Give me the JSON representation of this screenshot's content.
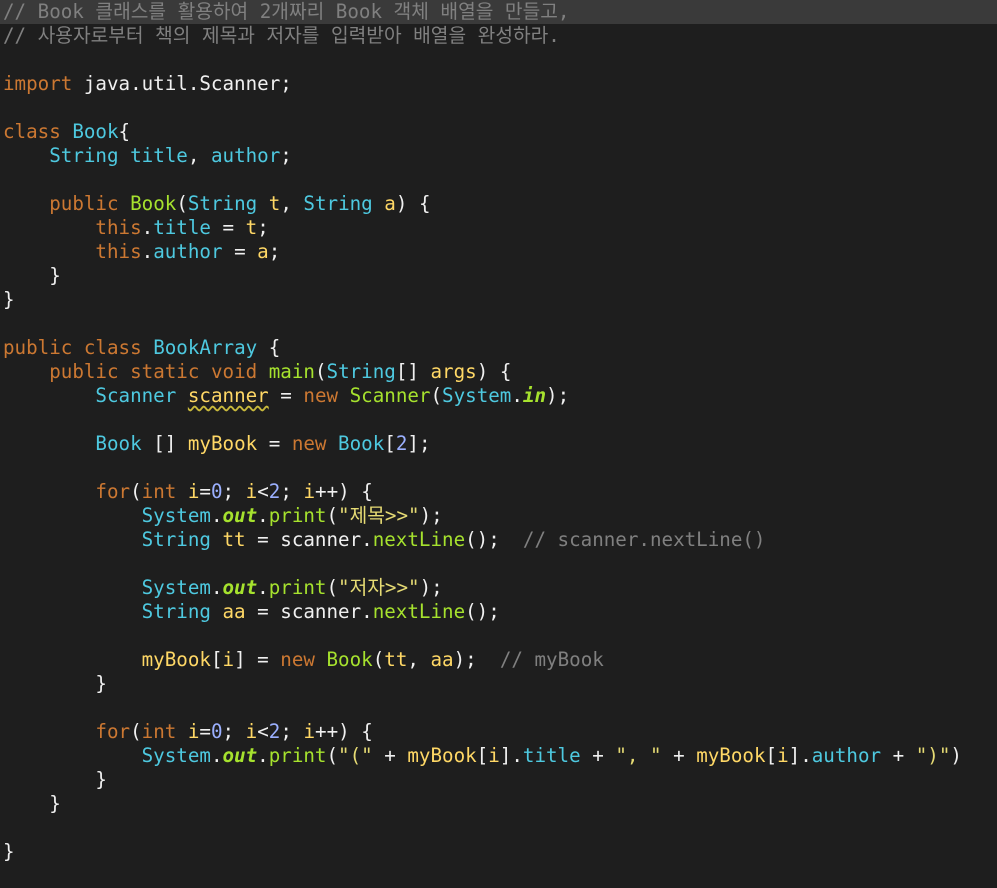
{
  "editor": {
    "language": "java",
    "colors": {
      "background": "#1e1e1e",
      "comment": "#808080",
      "keyword": "#cc7832",
      "type": "#4ec9e0",
      "method": "#a6e22e",
      "string": "#e6db74",
      "number": "#9bb0ff",
      "field": "#ffd866"
    },
    "lines": [
      {
        "highlight": true,
        "tokens": [
          {
            "t": "// Book 클래스를 활용하여 2개짜리 Book 객체 배열을 만들고,",
            "c": "comment"
          }
        ]
      },
      {
        "tokens": [
          {
            "t": "// 사용자로부터 책의 제목과 저자를 입력받아 배열을 완성하라.",
            "c": "comment"
          }
        ]
      },
      {
        "tokens": []
      },
      {
        "tokens": [
          {
            "t": "import",
            "c": "keyword"
          },
          {
            "t": " java.util.Scanner;",
            "c": "plain"
          }
        ]
      },
      {
        "tokens": []
      },
      {
        "tokens": [
          {
            "t": "class",
            "c": "keyword"
          },
          {
            "t": " ",
            "c": "plain"
          },
          {
            "t": "Book",
            "c": "class"
          },
          {
            "t": "{",
            "c": "plain"
          }
        ]
      },
      {
        "tokens": [
          {
            "t": "    ",
            "c": "plain"
          },
          {
            "t": "String",
            "c": "type"
          },
          {
            "t": " ",
            "c": "plain"
          },
          {
            "t": "title",
            "c": "type"
          },
          {
            "t": ", ",
            "c": "plain"
          },
          {
            "t": "author",
            "c": "type"
          },
          {
            "t": ";",
            "c": "plain"
          }
        ]
      },
      {
        "tokens": []
      },
      {
        "tokens": [
          {
            "t": "    ",
            "c": "plain"
          },
          {
            "t": "public",
            "c": "keyword"
          },
          {
            "t": " ",
            "c": "plain"
          },
          {
            "t": "Book",
            "c": "ctor"
          },
          {
            "t": "(",
            "c": "plain"
          },
          {
            "t": "String",
            "c": "type"
          },
          {
            "t": " ",
            "c": "plain"
          },
          {
            "t": "t",
            "c": "param"
          },
          {
            "t": ", ",
            "c": "plain"
          },
          {
            "t": "String",
            "c": "type"
          },
          {
            "t": " ",
            "c": "plain"
          },
          {
            "t": "a",
            "c": "param"
          },
          {
            "t": ") {",
            "c": "plain"
          }
        ]
      },
      {
        "tokens": [
          {
            "t": "        ",
            "c": "plain"
          },
          {
            "t": "this",
            "c": "keyword"
          },
          {
            "t": ".",
            "c": "plain"
          },
          {
            "t": "title",
            "c": "type"
          },
          {
            "t": " = ",
            "c": "plain"
          },
          {
            "t": "t",
            "c": "param"
          },
          {
            "t": ";",
            "c": "plain"
          }
        ]
      },
      {
        "tokens": [
          {
            "t": "        ",
            "c": "plain"
          },
          {
            "t": "this",
            "c": "keyword"
          },
          {
            "t": ".",
            "c": "plain"
          },
          {
            "t": "author",
            "c": "type"
          },
          {
            "t": " = ",
            "c": "plain"
          },
          {
            "t": "a",
            "c": "param"
          },
          {
            "t": ";",
            "c": "plain"
          }
        ]
      },
      {
        "tokens": [
          {
            "t": "    }",
            "c": "plain"
          }
        ]
      },
      {
        "tokens": [
          {
            "t": "}",
            "c": "plain"
          }
        ]
      },
      {
        "tokens": []
      },
      {
        "tokens": [
          {
            "t": "public",
            "c": "keyword"
          },
          {
            "t": " ",
            "c": "plain"
          },
          {
            "t": "class",
            "c": "keyword"
          },
          {
            "t": " ",
            "c": "plain"
          },
          {
            "t": "BookArray",
            "c": "class"
          },
          {
            "t": " {",
            "c": "plain"
          }
        ]
      },
      {
        "tokens": [
          {
            "t": "    ",
            "c": "plain"
          },
          {
            "t": "public",
            "c": "keyword"
          },
          {
            "t": " ",
            "c": "plain"
          },
          {
            "t": "static",
            "c": "keyword"
          },
          {
            "t": " ",
            "c": "plain"
          },
          {
            "t": "void",
            "c": "keyword"
          },
          {
            "t": " ",
            "c": "plain"
          },
          {
            "t": "main",
            "c": "method"
          },
          {
            "t": "(",
            "c": "plain"
          },
          {
            "t": "String",
            "c": "type"
          },
          {
            "t": "[] ",
            "c": "plain"
          },
          {
            "t": "args",
            "c": "param"
          },
          {
            "t": ") {",
            "c": "plain"
          }
        ]
      },
      {
        "tokens": [
          {
            "t": "        ",
            "c": "plain"
          },
          {
            "t": "Scanner",
            "c": "type"
          },
          {
            "t": " ",
            "c": "plain"
          },
          {
            "t": "scanner",
            "c": "field squiggle"
          },
          {
            "t": " = ",
            "c": "plain"
          },
          {
            "t": "new",
            "c": "keyword"
          },
          {
            "t": " ",
            "c": "plain"
          },
          {
            "t": "Scanner",
            "c": "ctor"
          },
          {
            "t": "(",
            "c": "plain"
          },
          {
            "t": "System",
            "c": "type"
          },
          {
            "t": ".",
            "c": "plain"
          },
          {
            "t": "in",
            "c": "static"
          },
          {
            "t": ");",
            "c": "plain"
          }
        ]
      },
      {
        "tokens": []
      },
      {
        "tokens": [
          {
            "t": "        ",
            "c": "plain"
          },
          {
            "t": "Book",
            "c": "type"
          },
          {
            "t": " [] ",
            "c": "plain"
          },
          {
            "t": "myBook",
            "c": "field"
          },
          {
            "t": " = ",
            "c": "plain"
          },
          {
            "t": "new",
            "c": "keyword"
          },
          {
            "t": " ",
            "c": "plain"
          },
          {
            "t": "Book",
            "c": "type"
          },
          {
            "t": "[",
            "c": "plain"
          },
          {
            "t": "2",
            "c": "number"
          },
          {
            "t": "];",
            "c": "plain"
          }
        ]
      },
      {
        "tokens": []
      },
      {
        "tokens": [
          {
            "t": "        ",
            "c": "plain"
          },
          {
            "t": "for",
            "c": "keyword"
          },
          {
            "t": "(",
            "c": "plain"
          },
          {
            "t": "int",
            "c": "keyword"
          },
          {
            "t": " ",
            "c": "plain"
          },
          {
            "t": "i",
            "c": "field"
          },
          {
            "t": "=",
            "c": "plain"
          },
          {
            "t": "0",
            "c": "number"
          },
          {
            "t": "; ",
            "c": "plain"
          },
          {
            "t": "i",
            "c": "field"
          },
          {
            "t": "<",
            "c": "plain"
          },
          {
            "t": "2",
            "c": "number"
          },
          {
            "t": "; ",
            "c": "plain"
          },
          {
            "t": "i",
            "c": "field"
          },
          {
            "t": "++) {",
            "c": "plain"
          }
        ]
      },
      {
        "tokens": [
          {
            "t": "            ",
            "c": "plain"
          },
          {
            "t": "System",
            "c": "type"
          },
          {
            "t": ".",
            "c": "plain"
          },
          {
            "t": "out",
            "c": "static"
          },
          {
            "t": ".",
            "c": "plain"
          },
          {
            "t": "print",
            "c": "method"
          },
          {
            "t": "(",
            "c": "plain"
          },
          {
            "t": "\"제목>>\"",
            "c": "string"
          },
          {
            "t": ");",
            "c": "plain"
          }
        ]
      },
      {
        "tokens": [
          {
            "t": "            ",
            "c": "plain"
          },
          {
            "t": "String",
            "c": "type"
          },
          {
            "t": " ",
            "c": "plain"
          },
          {
            "t": "tt",
            "c": "field"
          },
          {
            "t": " = ",
            "c": "plain"
          },
          {
            "t": "scanner",
            "c": "plain"
          },
          {
            "t": ".",
            "c": "plain"
          },
          {
            "t": "nextLine",
            "c": "method"
          },
          {
            "t": "();  ",
            "c": "plain"
          },
          {
            "t": "// scanner.nextLine()",
            "c": "comment"
          }
        ]
      },
      {
        "tokens": []
      },
      {
        "tokens": [
          {
            "t": "            ",
            "c": "plain"
          },
          {
            "t": "System",
            "c": "type"
          },
          {
            "t": ".",
            "c": "plain"
          },
          {
            "t": "out",
            "c": "static"
          },
          {
            "t": ".",
            "c": "plain"
          },
          {
            "t": "print",
            "c": "method"
          },
          {
            "t": "(",
            "c": "plain"
          },
          {
            "t": "\"저자>>\"",
            "c": "string"
          },
          {
            "t": ");",
            "c": "plain"
          }
        ]
      },
      {
        "tokens": [
          {
            "t": "            ",
            "c": "plain"
          },
          {
            "t": "String",
            "c": "type"
          },
          {
            "t": " ",
            "c": "plain"
          },
          {
            "t": "aa",
            "c": "field"
          },
          {
            "t": " = ",
            "c": "plain"
          },
          {
            "t": "scanner",
            "c": "plain"
          },
          {
            "t": ".",
            "c": "plain"
          },
          {
            "t": "nextLine",
            "c": "method"
          },
          {
            "t": "();",
            "c": "plain"
          }
        ]
      },
      {
        "tokens": []
      },
      {
        "tokens": [
          {
            "t": "            ",
            "c": "plain"
          },
          {
            "t": "myBook",
            "c": "field"
          },
          {
            "t": "[",
            "c": "plain"
          },
          {
            "t": "i",
            "c": "field"
          },
          {
            "t": "] = ",
            "c": "plain"
          },
          {
            "t": "new",
            "c": "keyword"
          },
          {
            "t": " ",
            "c": "plain"
          },
          {
            "t": "Book",
            "c": "ctor"
          },
          {
            "t": "(",
            "c": "plain"
          },
          {
            "t": "tt",
            "c": "field"
          },
          {
            "t": ", ",
            "c": "plain"
          },
          {
            "t": "aa",
            "c": "field"
          },
          {
            "t": ");  ",
            "c": "plain"
          },
          {
            "t": "// myBook",
            "c": "comment"
          }
        ]
      },
      {
        "tokens": [
          {
            "t": "        }",
            "c": "plain"
          }
        ]
      },
      {
        "tokens": []
      },
      {
        "tokens": [
          {
            "t": "        ",
            "c": "plain"
          },
          {
            "t": "for",
            "c": "keyword"
          },
          {
            "t": "(",
            "c": "plain"
          },
          {
            "t": "int",
            "c": "keyword"
          },
          {
            "t": " ",
            "c": "plain"
          },
          {
            "t": "i",
            "c": "field"
          },
          {
            "t": "=",
            "c": "plain"
          },
          {
            "t": "0",
            "c": "number"
          },
          {
            "t": "; ",
            "c": "plain"
          },
          {
            "t": "i",
            "c": "field"
          },
          {
            "t": "<",
            "c": "plain"
          },
          {
            "t": "2",
            "c": "number"
          },
          {
            "t": "; ",
            "c": "plain"
          },
          {
            "t": "i",
            "c": "field"
          },
          {
            "t": "++) {",
            "c": "plain"
          }
        ]
      },
      {
        "tokens": [
          {
            "t": "            ",
            "c": "plain"
          },
          {
            "t": "System",
            "c": "type"
          },
          {
            "t": ".",
            "c": "plain"
          },
          {
            "t": "out",
            "c": "static"
          },
          {
            "t": ".",
            "c": "plain"
          },
          {
            "t": "print",
            "c": "method"
          },
          {
            "t": "(",
            "c": "plain"
          },
          {
            "t": "\"(\"",
            "c": "string"
          },
          {
            "t": " + ",
            "c": "plain"
          },
          {
            "t": "myBook",
            "c": "field"
          },
          {
            "t": "[",
            "c": "plain"
          },
          {
            "t": "i",
            "c": "field"
          },
          {
            "t": "].",
            "c": "plain"
          },
          {
            "t": "title",
            "c": "type"
          },
          {
            "t": " + ",
            "c": "plain"
          },
          {
            "t": "\", \"",
            "c": "string"
          },
          {
            "t": " + ",
            "c": "plain"
          },
          {
            "t": "myBook",
            "c": "field"
          },
          {
            "t": "[",
            "c": "plain"
          },
          {
            "t": "i",
            "c": "field"
          },
          {
            "t": "].",
            "c": "plain"
          },
          {
            "t": "author",
            "c": "type"
          },
          {
            "t": " + ",
            "c": "plain"
          },
          {
            "t": "\")\"",
            "c": "string"
          },
          {
            "t": ")",
            "c": "plain"
          }
        ]
      },
      {
        "tokens": [
          {
            "t": "        }",
            "c": "plain"
          }
        ]
      },
      {
        "tokens": [
          {
            "t": "    }",
            "c": "plain"
          }
        ]
      },
      {
        "tokens": []
      },
      {
        "tokens": [
          {
            "t": "}",
            "c": "plain"
          }
        ]
      }
    ]
  }
}
